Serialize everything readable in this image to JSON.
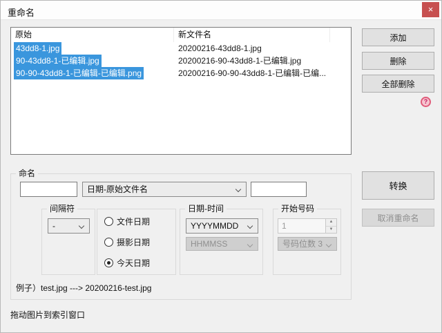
{
  "window": {
    "title": "重命名",
    "close_glyph": "×"
  },
  "colors": {
    "selection_blue": "#3a96dd",
    "close_button_red": "#c75050",
    "help_icon_pink": "#e05c7a",
    "dialog_background": "#f0f0f0"
  },
  "file_list": {
    "columns": {
      "original": "原始",
      "new_name": "新文件名"
    },
    "rows": [
      {
        "original": "43dd8-1.jpg",
        "new_name": "20200216-43dd8-1.jpg",
        "selected": true
      },
      {
        "original": "90-43dd8-1-已编辑.jpg",
        "new_name": "20200216-90-43dd8-1-已编辑.jpg",
        "selected": true
      },
      {
        "original": "90-90-43dd8-1-已编辑-已编辑.png",
        "new_name": "20200216-90-90-43dd8-1-已编辑-已编...",
        "selected": true
      }
    ]
  },
  "actions": {
    "add": "添加",
    "delete": "删除",
    "delete_all": "全部删除",
    "help_glyph": "?"
  },
  "naming": {
    "group_label": "命名",
    "prefix_value": "",
    "pattern_selected": "日期-原始文件名",
    "suffix_value": "",
    "separator": {
      "group_label": "间隔符",
      "selected": "-"
    },
    "date_source": {
      "options": [
        {
          "label": "文件日期",
          "checked": false
        },
        {
          "label": "摄影日期",
          "checked": false
        },
        {
          "label": "今天日期",
          "checked": true
        }
      ]
    },
    "datetime": {
      "group_label": "日期-时间",
      "date_format": "YYYYMMDD",
      "time_format": "HHMMSS"
    },
    "start_number": {
      "group_label": "开始号码",
      "value": "1",
      "digits_selected": "号码位数 3"
    },
    "example": "例子）test.jpg ---> 20200216-test.jpg"
  },
  "convert": {
    "convert": "转换",
    "cancel_rename": "取消重命名"
  },
  "status_bar": {
    "text": "拖动图片到索引窗口"
  }
}
